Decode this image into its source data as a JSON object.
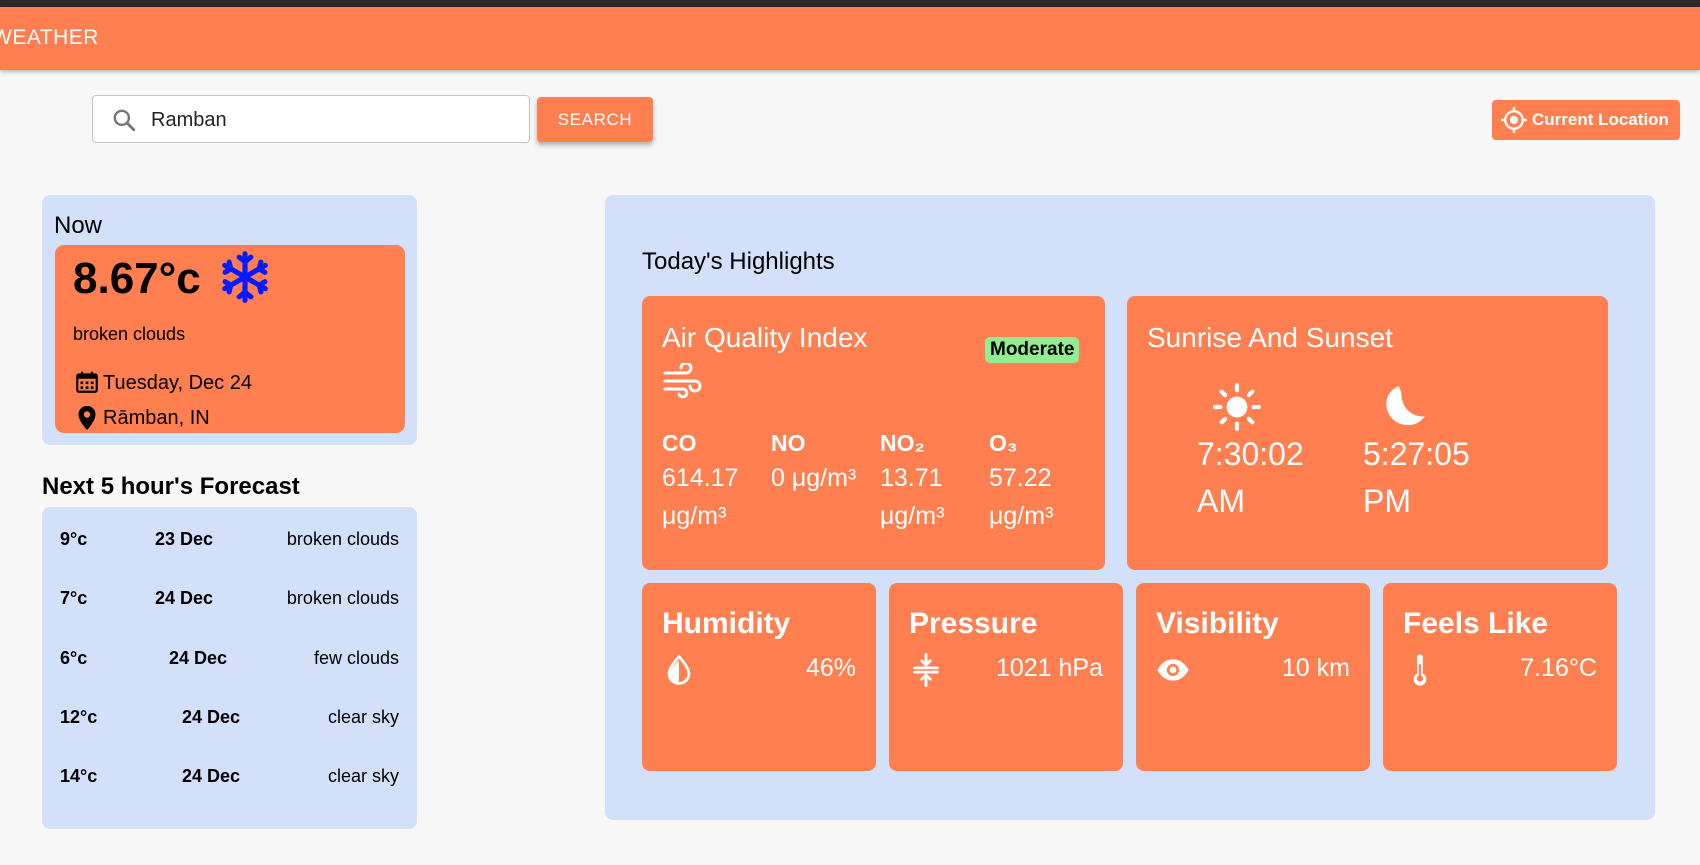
{
  "app": {
    "title": "WEATHER"
  },
  "search": {
    "value": "Ramban",
    "button_label": "SEARCH"
  },
  "location_button": {
    "label": "Current Location"
  },
  "now": {
    "heading": "Now",
    "temperature": "8.67°c",
    "description": "broken clouds",
    "date": "Tuesday, Dec 24",
    "location": "Rāmban, IN",
    "icon": "snowflake-icon"
  },
  "forecast": {
    "title": "Next 5 hour's Forecast",
    "items": [
      {
        "temp": "9°c",
        "date": "23 Dec",
        "desc": "broken clouds"
      },
      {
        "temp": "7°c",
        "date": "24 Dec",
        "desc": "broken clouds"
      },
      {
        "temp": "6°c",
        "date": "24 Dec",
        "desc": "few clouds"
      },
      {
        "temp": "12°c",
        "date": "24 Dec",
        "desc": "clear sky"
      },
      {
        "temp": "14°c",
        "date": "24 Dec",
        "desc": "clear sky"
      }
    ]
  },
  "highlights": {
    "title": "Today's Highlights",
    "aqi": {
      "title": "Air Quality Index",
      "badge": "Moderate",
      "badge_color": "#90ee90",
      "pollutants": [
        {
          "name": "CO",
          "value": "614.17 μg/m³"
        },
        {
          "name": "NO",
          "value": "0 μg/m³"
        },
        {
          "name": "NO₂",
          "value": "13.71 μg/m³"
        },
        {
          "name": "O₃",
          "value": "57.22 μg/m³"
        }
      ]
    },
    "sun": {
      "title": "Sunrise And Sunset",
      "sunrise": "7:30:02 AM",
      "sunset": "5:27:05 PM"
    },
    "humidity": {
      "title": "Humidity",
      "value": "46%",
      "icon": "droplet-icon"
    },
    "pressure": {
      "title": "Pressure",
      "value": "1021 hPa",
      "icon": "compress-icon"
    },
    "visibility": {
      "title": "Visibility",
      "value": "10 km",
      "icon": "eye-icon"
    },
    "feels_like": {
      "title": "Feels Like",
      "value": "7.16°C",
      "icon": "thermometer-icon"
    }
  },
  "colors": {
    "accent": "#ff7f50",
    "panel": "#d3e0fa",
    "background": "#f7f7f7"
  }
}
